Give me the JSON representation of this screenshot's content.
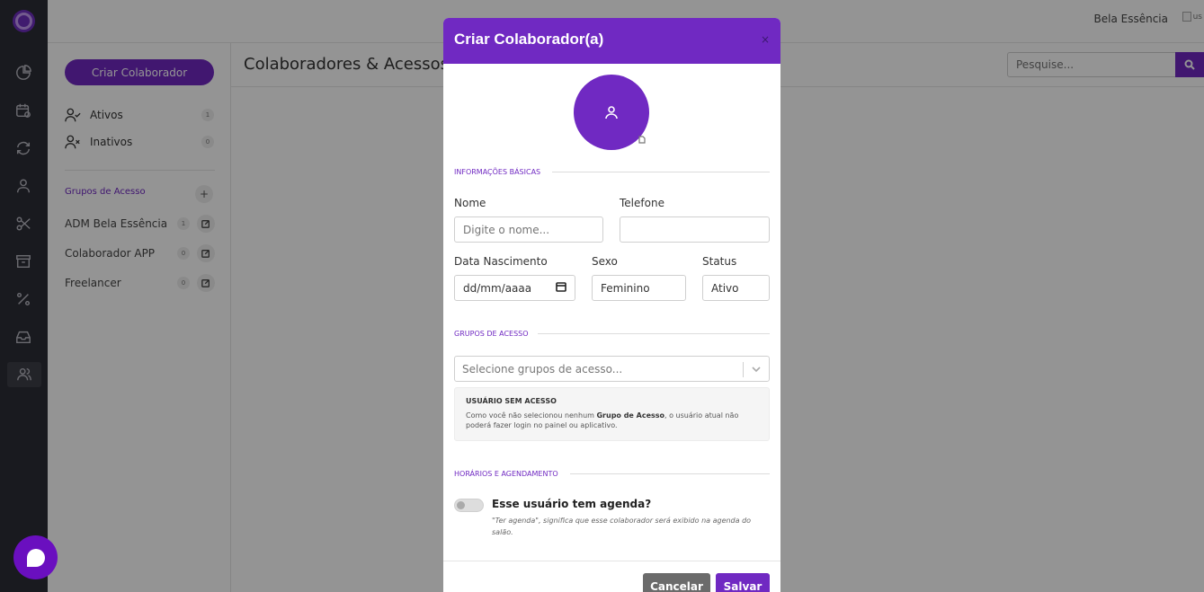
{
  "header": {
    "store_name": "Bela Essência",
    "avatar_alt": "us"
  },
  "rail": {
    "icons": [
      "logo-icon",
      "chart-icon",
      "calendar-icon",
      "sync-icon",
      "user-icon",
      "scissors-icon",
      "archive-icon",
      "percent-icon",
      "inbox-icon",
      "users-icon"
    ],
    "active": "users-icon"
  },
  "sidebar": {
    "create_button": "Criar Colaborador",
    "filters": [
      {
        "label": "Ativos",
        "count": "1"
      },
      {
        "label": "Inativos",
        "count": "0"
      }
    ],
    "groups_title": "Grupos de Acesso",
    "groups": [
      {
        "label": "ADM Bela Essência",
        "count": "1"
      },
      {
        "label": "Colaborador APP",
        "count": "0"
      },
      {
        "label": "Freelancer",
        "count": "0"
      }
    ]
  },
  "main": {
    "title": "Colaboradores & Acessos",
    "search_placeholder": "Pesquise..."
  },
  "modal": {
    "title": "Criar Colaborador(a)",
    "close": "×",
    "section_basic": "Informações Básicas",
    "fields": {
      "name_label": "Nome",
      "name_placeholder": "Digite o nome...",
      "phone_label": "Telefone",
      "phone_value": "",
      "birth_label": "Data Nascimento",
      "birth_value": "dd/mm/aaaa",
      "sex_label": "Sexo",
      "sex_value": "Feminino",
      "status_label": "Status",
      "status_value": "Ativo"
    },
    "section_groups": "Grupos de Acesso",
    "groups_placeholder": "Selecione grupos de acesso...",
    "notice": {
      "title": "USUÁRIO SEM ACESSO",
      "text_before": "Como você não selecionou nenhum ",
      "text_bold": "Grupo de Acesso",
      "text_after": ", o usuário atual não poderá fazer login no painel ou aplicativo."
    },
    "section_schedule": "Horários e Agendamento",
    "agenda": {
      "title": "Esse usuário tem agenda?",
      "desc": "\"Ter agenda\", significa que esse colaborador será exibido na agenda do salão.",
      "enabled": false
    },
    "buttons": {
      "cancel": "Cancelar",
      "save": "Salvar"
    }
  },
  "colors": {
    "brand": "#7029c2",
    "rail": "#2c2d36",
    "cancel": "#6b6b6b"
  }
}
